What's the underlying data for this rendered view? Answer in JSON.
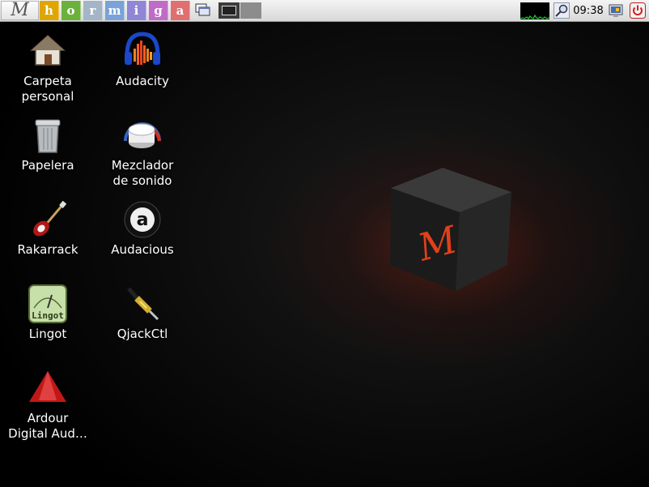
{
  "taskbar": {
    "menu_logo": "M",
    "launchers": [
      {
        "letter": "h",
        "color": "#e0a500"
      },
      {
        "letter": "o",
        "color": "#6bb23c"
      },
      {
        "letter": "r",
        "color": "#a3b5c6"
      },
      {
        "letter": "m",
        "color": "#79a3d8"
      },
      {
        "letter": "i",
        "color": "#8f86d6"
      },
      {
        "letter": "g",
        "color": "#c06bc8"
      },
      {
        "letter": "a",
        "color": "#e07070"
      }
    ],
    "clock": "09:38",
    "icons": [
      "show-desktop-icon",
      "workspace-pager",
      "cpu-monitor",
      "search-icon",
      "tray-icon",
      "power-icon"
    ]
  },
  "desktop": {
    "icons": [
      {
        "label": "Carpeta\npersonal",
        "icon": "home-icon"
      },
      {
        "label": "Audacity",
        "icon": "audacity-icon"
      },
      {
        "label": "Papelera",
        "icon": "trash-icon"
      },
      {
        "label": "Mezclador\nde sonido",
        "icon": "mixer-icon"
      },
      {
        "label": "Rakarrack",
        "icon": "guitar-icon"
      },
      {
        "label": "Audacious",
        "icon": "audacious-icon"
      },
      {
        "label": "Lingot",
        "icon": "lingot-icon"
      },
      {
        "label": "QjackCtl",
        "icon": "jack-cable-icon"
      },
      {
        "label": "Ardour\nDigital Aud…",
        "icon": "ardour-icon"
      }
    ]
  },
  "wallpaper": {
    "cube_logo": "M",
    "accent": "#e0401a"
  },
  "icon_inner": {
    "lingot_text": "Lingot",
    "audacious_letter": "a"
  }
}
